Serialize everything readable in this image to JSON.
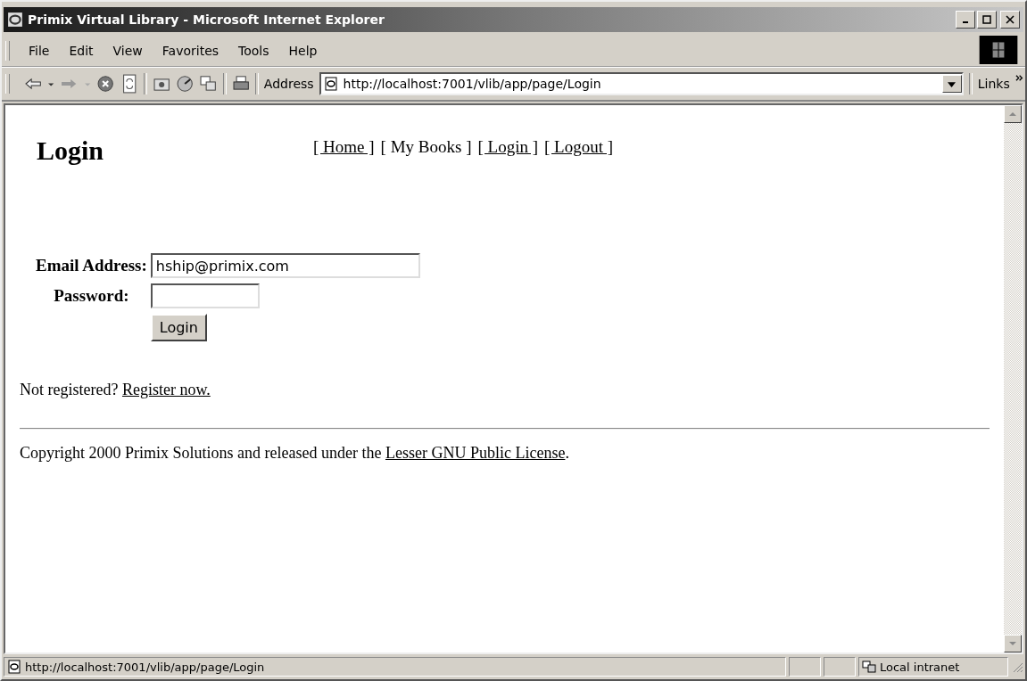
{
  "window": {
    "title": "Primix Virtual Library - Microsoft Internet Explorer"
  },
  "menu": [
    "File",
    "Edit",
    "View",
    "Favorites",
    "Tools",
    "Help"
  ],
  "address": {
    "label": "Address",
    "value": "http://localhost:7001/vlib/app/page/Login",
    "links": "Links"
  },
  "page": {
    "heading": "Login",
    "nav": [
      {
        "label": "[ Home ]",
        "link": true
      },
      {
        "label": "[ My Books ]",
        "link": false
      },
      {
        "label": "[ Login ]",
        "link": true
      },
      {
        "label": "[ Logout ]",
        "link": true
      }
    ],
    "email": {
      "label": "Email Address:",
      "value": "hship@primix.com"
    },
    "password": {
      "label": "Password:"
    },
    "login_button": "Login",
    "register": {
      "text": "Not registered?",
      "link": "Register now."
    },
    "copyright": {
      "text": "Copyright 2000 Primix Solutions and released under the",
      "link": "Lesser GNU Public License",
      "end": "."
    }
  },
  "status_bar": {
    "url": "http://localhost:7001/vlib/app/page/Login",
    "zone": "Local intranet"
  }
}
